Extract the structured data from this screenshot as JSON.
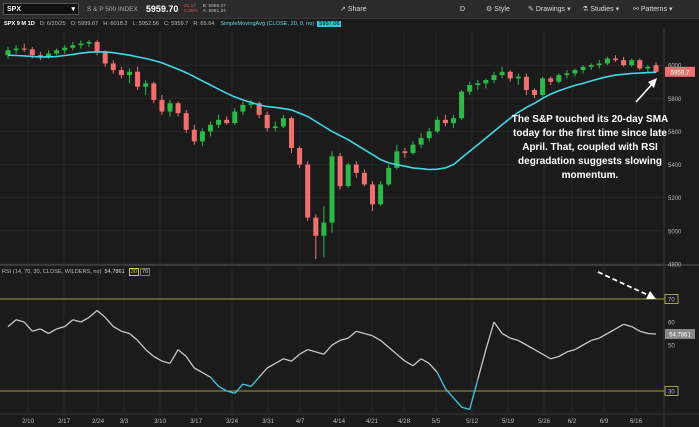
{
  "toolbar": {
    "symbol": "SPX",
    "name": "S & P 500 INDEX",
    "price": "5959.70",
    "change": "-21.17",
    "change_pct": "-0.35%",
    "bid": "B: 5958.37",
    "ask": "A: 5961.24",
    "share": "Share",
    "d": "D",
    "style": "Style",
    "drawings": "Drawings",
    "studies": "Studies",
    "patterns": "Patterns"
  },
  "quote": {
    "title": "SPX 9 M 1D",
    "date": "D: 6/20/25",
    "open": "O: 5999.67",
    "high": "H: 6018.2",
    "low": "L: 5952.56",
    "close": "C: 5959.7",
    "range": "R: 65.64",
    "sma_label": "SimpleMovingAvg (CLOSE, 20, 0, no)",
    "sma_value": "5957.06"
  },
  "annotation": "The S&P touched its 20-day SMA today for the first time since late April. That, coupled with RSI degradation suggests slowing momentum.",
  "rsi": {
    "label": "RSI (14, 70, 30, CLOSE, WILDERS, no)",
    "value": "54.7861",
    "ob": "30",
    "os": "70"
  },
  "colors": {
    "up": "#2db84a",
    "down": "#f07070",
    "sma": "#40d8e8",
    "rsi": "#c8c8c8",
    "rsi_low": "#40c8e8",
    "level": "#c8c850",
    "bg": "#1b1b1b",
    "grid": "#2e2e2e",
    "price_tag": "#f07070"
  },
  "chart_data": [
    {
      "type": "candlestick",
      "title": "SPX 9 M 1D",
      "ylim": [
        4800,
        6200
      ],
      "y_ticks": [
        "4800",
        "5000",
        "5200",
        "5400",
        "5600",
        "5800",
        "6000"
      ],
      "x_ticks": [
        "2/10",
        "2/17",
        "2/24",
        "3/3",
        "3/10",
        "3/17",
        "3/24",
        "3/31",
        "4/7",
        "4/14",
        "4/21",
        "4/28",
        "5/5",
        "5/12",
        "5/19",
        "5/26",
        "6/2",
        "6/9",
        "6/16"
      ],
      "last_price": "5959.7",
      "ohlc": [
        [
          6060,
          6110,
          6040,
          6090
        ],
        [
          6090,
          6120,
          6070,
          6100
        ],
        [
          6100,
          6130,
          6080,
          6095
        ],
        [
          6095,
          6110,
          6040,
          6060
        ],
        [
          6060,
          6080,
          6030,
          6050
        ],
        [
          6050,
          6090,
          6040,
          6070
        ],
        [
          6070,
          6100,
          6060,
          6090
        ],
        [
          6090,
          6120,
          6070,
          6105
        ],
        [
          6105,
          6140,
          6090,
          6120
        ],
        [
          6120,
          6150,
          6100,
          6130
        ],
        [
          6130,
          6150,
          6110,
          6140
        ],
        [
          6140,
          6150,
          6060,
          6080
        ],
        [
          6080,
          6090,
          5990,
          6010
        ],
        [
          6010,
          6030,
          5950,
          5970
        ],
        [
          5970,
          5990,
          5920,
          5940
        ],
        [
          5940,
          5980,
          5890,
          5960
        ],
        [
          5960,
          5990,
          5850,
          5870
        ],
        [
          5870,
          5910,
          5820,
          5890
        ],
        [
          5890,
          5900,
          5770,
          5790
        ],
        [
          5790,
          5820,
          5700,
          5720
        ],
        [
          5720,
          5790,
          5690,
          5770
        ],
        [
          5770,
          5780,
          5690,
          5710
        ],
        [
          5710,
          5730,
          5590,
          5610
        ],
        [
          5610,
          5640,
          5520,
          5540
        ],
        [
          5540,
          5620,
          5510,
          5600
        ],
        [
          5600,
          5660,
          5570,
          5640
        ],
        [
          5640,
          5700,
          5620,
          5670
        ],
        [
          5670,
          5690,
          5640,
          5650
        ],
        [
          5650,
          5740,
          5640,
          5720
        ],
        [
          5720,
          5780,
          5700,
          5760
        ],
        [
          5760,
          5790,
          5740,
          5770
        ],
        [
          5770,
          5780,
          5680,
          5700
        ],
        [
          5700,
          5720,
          5600,
          5620
        ],
        [
          5620,
          5660,
          5600,
          5630
        ],
        [
          5630,
          5700,
          5620,
          5680
        ],
        [
          5680,
          5690,
          5470,
          5500
        ],
        [
          5500,
          5510,
          5380,
          5400
        ],
        [
          5400,
          5420,
          5060,
          5080
        ],
        [
          5080,
          5100,
          4830,
          4970
        ],
        [
          4970,
          5150,
          4840,
          5050
        ],
        [
          5050,
          5480,
          4990,
          5450
        ],
        [
          5450,
          5470,
          5250,
          5270
        ],
        [
          5270,
          5410,
          5260,
          5400
        ],
        [
          5400,
          5420,
          5320,
          5350
        ],
        [
          5350,
          5370,
          5270,
          5280
        ],
        [
          5280,
          5300,
          5120,
          5160
        ],
        [
          5160,
          5300,
          5150,
          5280
        ],
        [
          5280,
          5400,
          5270,
          5380
        ],
        [
          5380,
          5520,
          5370,
          5480
        ],
        [
          5480,
          5500,
          5440,
          5470
        ],
        [
          5470,
          5540,
          5460,
          5520
        ],
        [
          5520,
          5590,
          5500,
          5560
        ],
        [
          5560,
          5620,
          5540,
          5600
        ],
        [
          5600,
          5690,
          5590,
          5670
        ],
        [
          5670,
          5700,
          5630,
          5650
        ],
        [
          5650,
          5700,
          5620,
          5680
        ],
        [
          5680,
          5850,
          5670,
          5840
        ],
        [
          5840,
          5900,
          5820,
          5880
        ],
        [
          5880,
          5910,
          5850,
          5890
        ],
        [
          5890,
          5920,
          5860,
          5910
        ],
        [
          5910,
          5960,
          5890,
          5940
        ],
        [
          5940,
          5990,
          5920,
          5960
        ],
        [
          5960,
          5970,
          5900,
          5920
        ],
        [
          5920,
          5950,
          5880,
          5930
        ],
        [
          5930,
          5950,
          5820,
          5850
        ],
        [
          5850,
          5860,
          5800,
          5820
        ],
        [
          5820,
          5930,
          5810,
          5920
        ],
        [
          5920,
          5930,
          5880,
          5900
        ],
        [
          5900,
          5950,
          5890,
          5940
        ],
        [
          5940,
          5970,
          5920,
          5950
        ],
        [
          5950,
          5980,
          5930,
          5970
        ],
        [
          5970,
          6000,
          5950,
          5990
        ],
        [
          5990,
          6010,
          5970,
          6000
        ],
        [
          6000,
          6030,
          5980,
          6010
        ],
        [
          6010,
          6050,
          6000,
          6040
        ],
        [
          6040,
          6060,
          6020,
          6030
        ],
        [
          6030,
          6050,
          5990,
          6000
        ],
        [
          6000,
          6040,
          5990,
          6030
        ],
        [
          6030,
          6040,
          5970,
          5980
        ],
        [
          5980,
          6000,
          5950,
          5990
        ],
        [
          5999.67,
          6018.2,
          5952.56,
          5959.7
        ]
      ],
      "sma20": [
        6060,
        6058,
        6056,
        6052,
        6050,
        6050,
        6052,
        6058,
        6065,
        6072,
        6078,
        6080,
        6080,
        6075,
        6068,
        6060,
        6050,
        6040,
        6028,
        6015,
        5995,
        5975,
        5955,
        5930,
        5905,
        5880,
        5855,
        5830,
        5808,
        5790,
        5775,
        5760,
        5750,
        5745,
        5738,
        5730,
        5710,
        5690,
        5660,
        5630,
        5600,
        5575,
        5550,
        5520,
        5490,
        5460,
        5430,
        5410,
        5400,
        5390,
        5380,
        5375,
        5370,
        5372,
        5380,
        5400,
        5440,
        5480,
        5520,
        5560,
        5600,
        5640,
        5680,
        5715,
        5745,
        5770,
        5800,
        5825,
        5845,
        5862,
        5878,
        5890,
        5905,
        5918,
        5930,
        5940,
        5945,
        5950,
        5952,
        5955,
        5957.06
      ],
      "rsi_ylim": [
        20,
        80
      ],
      "rsi_ticks": [
        "30",
        "50",
        "60",
        "70"
      ],
      "rsi_levels": [
        70,
        30
      ],
      "rsi_last": "54.7861",
      "rsi_values": [
        58,
        61,
        60,
        56,
        57,
        55,
        57,
        58,
        61,
        60,
        62,
        65,
        62,
        58,
        56,
        55,
        52,
        48,
        45,
        43,
        42,
        48,
        45,
        40,
        38,
        36,
        32,
        30,
        29,
        33,
        32,
        36,
        40,
        42,
        44,
        43,
        46,
        48,
        47,
        46,
        50,
        52,
        53,
        56,
        55,
        54,
        52,
        49,
        46,
        43,
        41,
        44,
        42,
        38,
        31,
        27,
        23,
        22,
        35,
        48,
        60,
        55,
        53,
        52,
        50,
        48,
        46,
        44,
        45,
        47,
        48,
        50,
        52,
        53,
        55,
        57,
        59,
        58,
        56,
        55,
        54.7861
      ]
    }
  ]
}
